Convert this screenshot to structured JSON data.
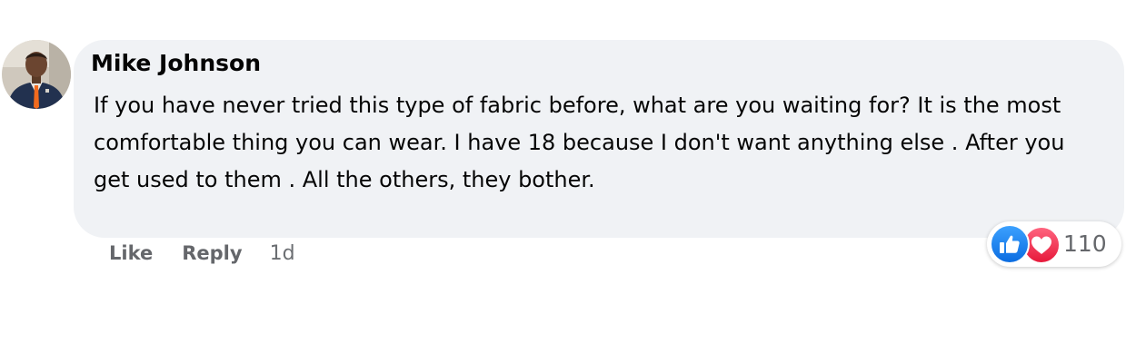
{
  "comment": {
    "author": "Mike Johnson",
    "text": "If you have never tried this type of fabric before, what are you waiting for? It is the most comfortable thing you can wear. I have 18 because I don't want anything else . After you get used to them . All the others, they bother.",
    "timestamp": "1d"
  },
  "actions": {
    "like_label": "Like",
    "reply_label": "Reply"
  },
  "reactions": {
    "count": "110",
    "icons": [
      "like-reaction-icon",
      "love-reaction-icon"
    ],
    "colors": {
      "like": "#1877f2",
      "love": "#f33e58"
    }
  },
  "colors": {
    "bubble": "#f0f2f5",
    "text": "#050505",
    "secondary": "#65676b"
  }
}
